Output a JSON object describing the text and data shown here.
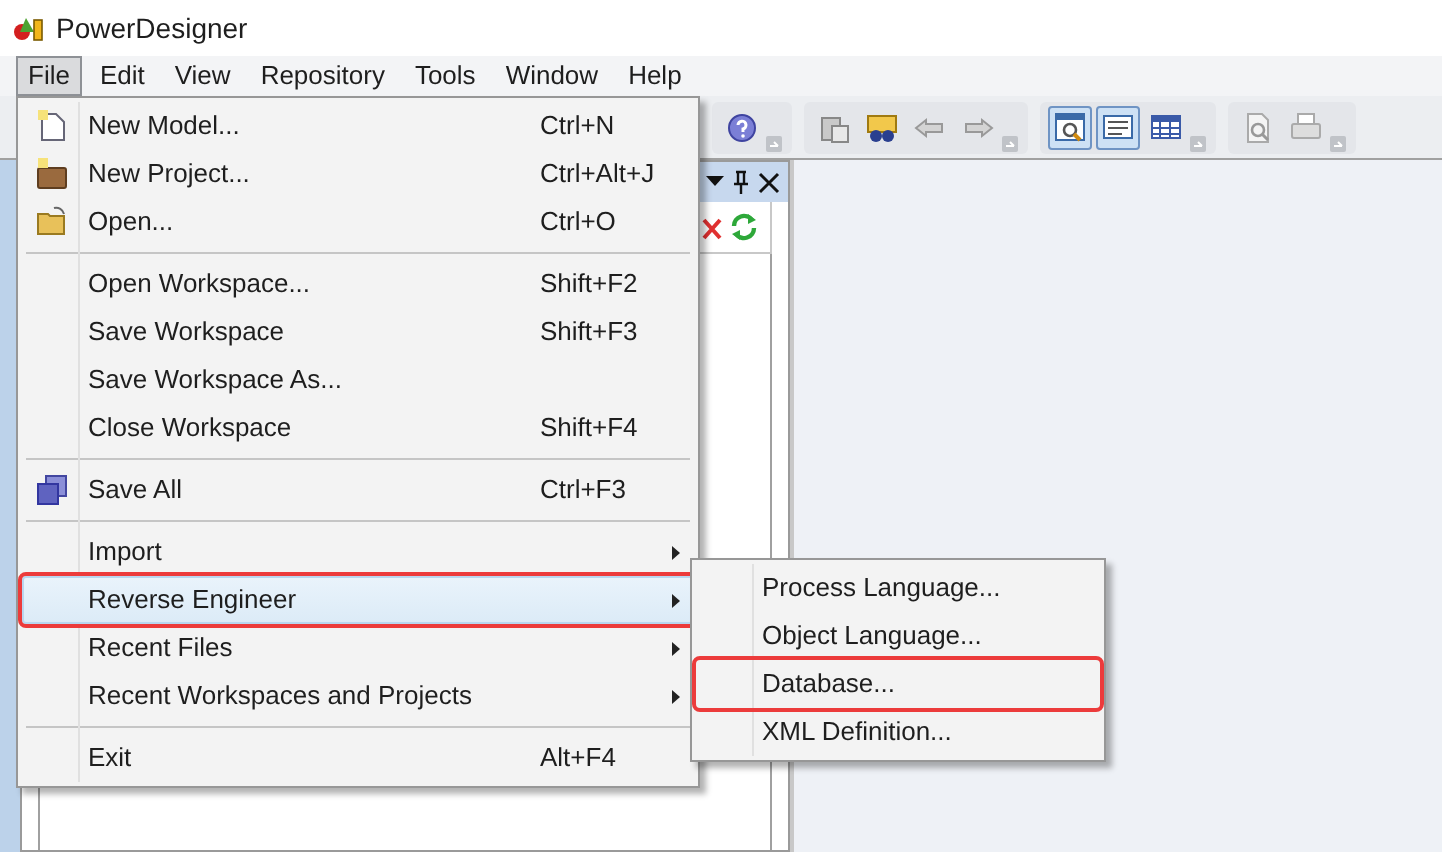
{
  "window": {
    "title": "PowerDesigner"
  },
  "menubar": [
    {
      "label": "File",
      "selected": true
    },
    {
      "label": "Edit",
      "selected": false
    },
    {
      "label": "View",
      "selected": false
    },
    {
      "label": "Repository",
      "selected": false
    },
    {
      "label": "Tools",
      "selected": false
    },
    {
      "label": "Window",
      "selected": false
    },
    {
      "label": "Help",
      "selected": false
    }
  ],
  "toolbar": [
    {
      "kind": "help",
      "pressed": false
    },
    {
      "kind": "grip"
    },
    {
      "kind": "paste",
      "pressed": false
    },
    {
      "kind": "find",
      "pressed": false
    },
    {
      "kind": "back",
      "pressed": false
    },
    {
      "kind": "forward",
      "pressed": false
    },
    {
      "kind": "grip"
    },
    {
      "kind": "zoom",
      "pressed": true
    },
    {
      "kind": "text",
      "pressed": true
    },
    {
      "kind": "table",
      "pressed": false
    },
    {
      "kind": "grip"
    },
    {
      "kind": "preview",
      "pressed": false
    },
    {
      "kind": "print",
      "pressed": false
    },
    {
      "kind": "grip"
    }
  ],
  "file_menu": {
    "items": [
      {
        "kind": "item",
        "label": "New Model...",
        "shortcut": "Ctrl+N",
        "selected": false,
        "annotated": false
      },
      {
        "kind": "item",
        "label": "New Project...",
        "shortcut": "Ctrl+Alt+J",
        "selected": false,
        "annotated": false
      },
      {
        "kind": "item",
        "label": "Open...",
        "shortcut": "Ctrl+O",
        "selected": false,
        "annotated": false
      },
      {
        "kind": "separator"
      },
      {
        "kind": "item",
        "label": "Open Workspace...",
        "shortcut": "Shift+F2",
        "selected": false,
        "annotated": false
      },
      {
        "kind": "item",
        "label": "Save Workspace",
        "shortcut": "Shift+F3",
        "selected": false,
        "annotated": false
      },
      {
        "kind": "item",
        "label": "Save Workspace As...",
        "selected": false,
        "annotated": false
      },
      {
        "kind": "item",
        "label": "Close Workspace",
        "shortcut": "Shift+F4",
        "selected": false,
        "annotated": false
      },
      {
        "kind": "separator"
      },
      {
        "kind": "item",
        "label": "Save All",
        "shortcut": "Ctrl+F3",
        "selected": false,
        "annotated": false
      },
      {
        "kind": "separator"
      },
      {
        "kind": "submenu",
        "label": "Import",
        "selected": false,
        "annotated": false
      },
      {
        "kind": "submenu",
        "label": "Reverse Engineer",
        "selected": true,
        "annotated": true
      },
      {
        "kind": "submenu",
        "label": "Recent Files",
        "selected": false,
        "annotated": false
      },
      {
        "kind": "submenu",
        "label": "Recent Workspaces and Projects",
        "selected": false,
        "annotated": false
      },
      {
        "kind": "separator"
      },
      {
        "kind": "item",
        "label": "Exit",
        "shortcut": "Alt+F4",
        "selected": false,
        "annotated": false
      }
    ]
  },
  "submenu": {
    "items": [
      {
        "label": "Process Language...",
        "selected": false,
        "annotated": false
      },
      {
        "label": "Object Language...",
        "selected": false,
        "annotated": false
      },
      {
        "label": "Database...",
        "selected": false,
        "annotated": true
      },
      {
        "label": "XML Definition...",
        "selected": false,
        "annotated": false
      }
    ]
  }
}
